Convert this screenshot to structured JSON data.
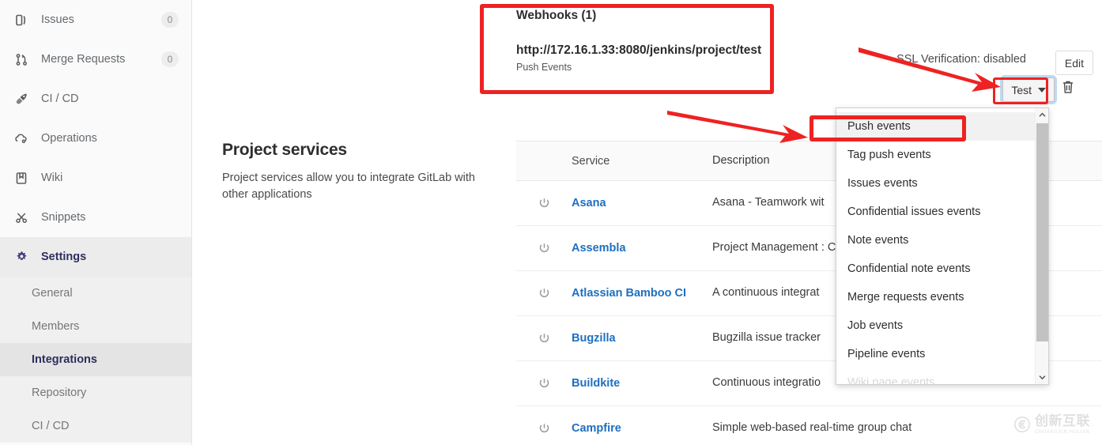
{
  "sidebar": {
    "items": [
      {
        "label": "Issues",
        "icon": "issues-icon",
        "badge": "0"
      },
      {
        "label": "Merge Requests",
        "icon": "merge-request-icon",
        "badge": "0"
      },
      {
        "label": "CI / CD",
        "icon": "rocket-icon",
        "badge": ""
      },
      {
        "label": "Operations",
        "icon": "cloud-gear-icon",
        "badge": ""
      },
      {
        "label": "Wiki",
        "icon": "book-icon",
        "badge": ""
      },
      {
        "label": "Snippets",
        "icon": "scissors-icon",
        "badge": ""
      }
    ],
    "settings": {
      "label": "Settings",
      "icon": "gear-icon"
    },
    "sub_items": [
      {
        "label": "General",
        "active": false
      },
      {
        "label": "Members",
        "active": false
      },
      {
        "label": "Integrations",
        "active": true
      },
      {
        "label": "Repository",
        "active": false
      },
      {
        "label": "CI / CD",
        "active": false
      }
    ]
  },
  "webhooks": {
    "title": "Webhooks (1)",
    "url": "http://172.16.1.33:8080/jenkins/project/test",
    "events": "Push Events",
    "ssl_status": "SSL Verification: disabled",
    "edit_label": "Edit",
    "test_label": "Test",
    "delete_icon": "trash-icon"
  },
  "dropdown": {
    "items": [
      "Push events",
      "Tag push events",
      "Issues events",
      "Confidential issues events",
      "Note events",
      "Confidential note events",
      "Merge requests events",
      "Job events",
      "Pipeline events",
      "Wiki page events"
    ],
    "highlighted_index": 0
  },
  "project_services": {
    "title": "Project services",
    "description": "Project services allow you to integrate GitLab with other applications",
    "columns": {
      "icon": "",
      "service": "Service",
      "description": "Description"
    },
    "rows": [
      {
        "icon": "power-icon",
        "service": "Asana",
        "description": "Asana - Teamwork wit"
      },
      {
        "icon": "power-icon",
        "service": "Assembla",
        "description": "Project Management : Commits Endpoint)"
      },
      {
        "icon": "power-icon",
        "service": "Atlassian Bamboo CI",
        "description": "A continuous integrat"
      },
      {
        "icon": "power-icon",
        "service": "Bugzilla",
        "description": "Bugzilla issue tracker"
      },
      {
        "icon": "power-icon",
        "service": "Buildkite",
        "description": "Continuous integratio"
      },
      {
        "icon": "power-icon",
        "service": "Campfire",
        "description": "Simple web-based real-time group chat"
      }
    ]
  },
  "watermark": {
    "cn": "创新互联",
    "en": "CHUANGXIN HULIAN"
  },
  "colors": {
    "accent_red": "#ee2222",
    "link_blue": "#1f6fbf",
    "active_navy": "#2e2e5f"
  }
}
